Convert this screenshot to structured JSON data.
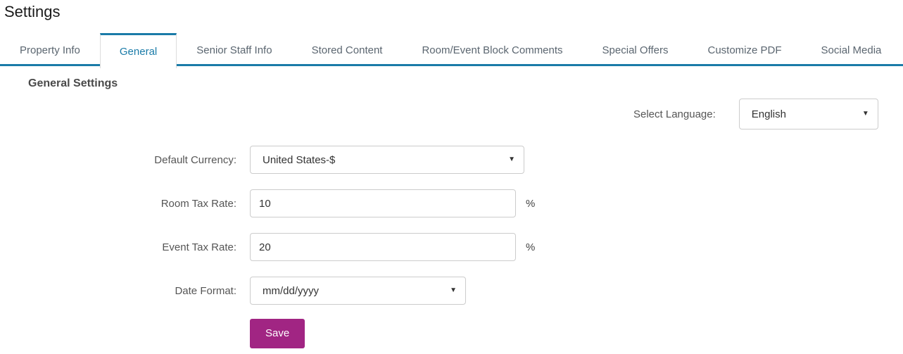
{
  "page": {
    "title": "Settings"
  },
  "tabs": [
    {
      "label": "Property Info",
      "active": false
    },
    {
      "label": "General",
      "active": true
    },
    {
      "label": "Senior Staff Info",
      "active": false
    },
    {
      "label": "Stored Content",
      "active": false
    },
    {
      "label": "Room/Event Block Comments",
      "active": false
    },
    {
      "label": "Special Offers",
      "active": false
    },
    {
      "label": "Customize PDF",
      "active": false
    },
    {
      "label": "Social Media",
      "active": false
    }
  ],
  "section": {
    "heading": "General Settings"
  },
  "language": {
    "label": "Select Language:",
    "value": "English",
    "caret": "▼"
  },
  "form": {
    "currency": {
      "label": "Default Currency:",
      "value": "United States-$",
      "caret": "▼"
    },
    "room_tax": {
      "label": "Room Tax Rate:",
      "value": "10",
      "suffix": "%"
    },
    "event_tax": {
      "label": "Event Tax Rate:",
      "value": "20",
      "suffix": "%"
    },
    "date_format": {
      "label": "Date Format:",
      "value": "mm/dd/yyyy",
      "caret": "▼"
    },
    "save_label": "Save"
  },
  "colors": {
    "accent_blue": "#1a7ba8",
    "save_magenta": "#a12583",
    "label_gray": "#555555",
    "border_gray": "#cccccc"
  }
}
